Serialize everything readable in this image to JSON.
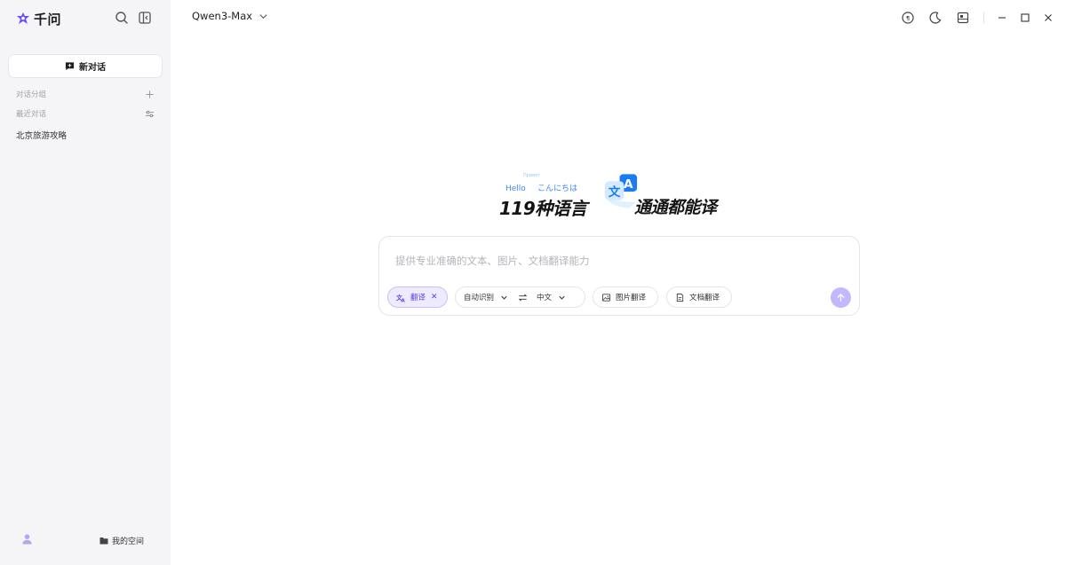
{
  "app": {
    "name": "千问"
  },
  "sidebar": {
    "new_chat_label": "新对话",
    "sections": [
      {
        "label": "对话分组",
        "action_icon": "plus-icon"
      },
      {
        "label": "最近对话",
        "action_icon": "sliders-icon"
      }
    ],
    "conversations": [
      "北京旅游攻略"
    ],
    "my_space_label": "我的空间"
  },
  "header": {
    "model": "Qwen3-Max"
  },
  "hero": {
    "small_texts": [
      "Hello",
      "こんにちは",
      "Привет"
    ],
    "title_left": "119种语言",
    "title_right": "通通都能译",
    "badge_glyphs": [
      "文",
      "A"
    ]
  },
  "composer": {
    "placeholder": "提供专业准确的文本、图片、文档翻译能力",
    "value": "",
    "chips": {
      "translate": "翻译",
      "source_lang": "自动识别",
      "target_lang": "中文",
      "image_translate": "图片翻译",
      "doc_translate": "文档翻译"
    }
  },
  "colors": {
    "brand": "#6b4df5",
    "accent_blue": "#1a7cf5",
    "send_disabled": "#c4b7fc",
    "sidebar_bg": "#f5f5f7"
  }
}
